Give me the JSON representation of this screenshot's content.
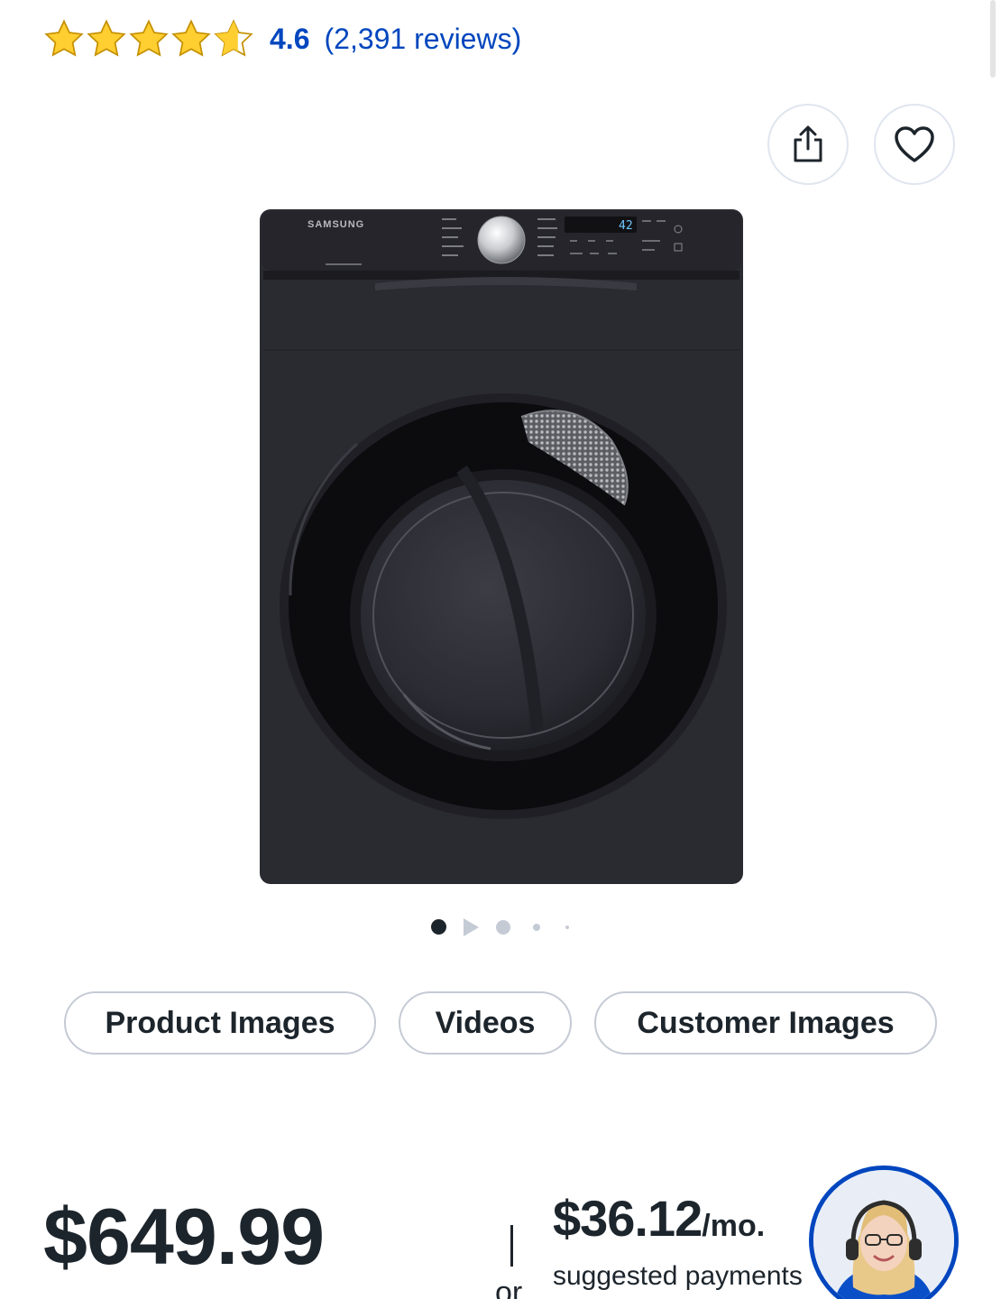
{
  "rating": {
    "stars_value": 4.6,
    "score": "4.6",
    "count": "(2,391 reviews)"
  },
  "actions": {
    "share_icon": "share-icon",
    "save_icon": "heart-icon"
  },
  "product": {
    "brand_on_image": "SAMSUNG",
    "display_readout": "42"
  },
  "carousel": {
    "active_index": 1
  },
  "media_tabs": [
    {
      "label": "Product Images"
    },
    {
      "label": "Videos"
    },
    {
      "label": "Customer Images"
    }
  ],
  "pricing": {
    "price": "$649.99",
    "separator": "|",
    "or": "or",
    "monthly_amount": "$36.12",
    "monthly_suffix": "/mo.",
    "monthly_note": "suggested payments"
  },
  "colors": {
    "accent_blue": "#0046be",
    "star_yellow": "#ffce31",
    "text_dark": "#1d252c",
    "border_gray": "#c5cbd5"
  }
}
